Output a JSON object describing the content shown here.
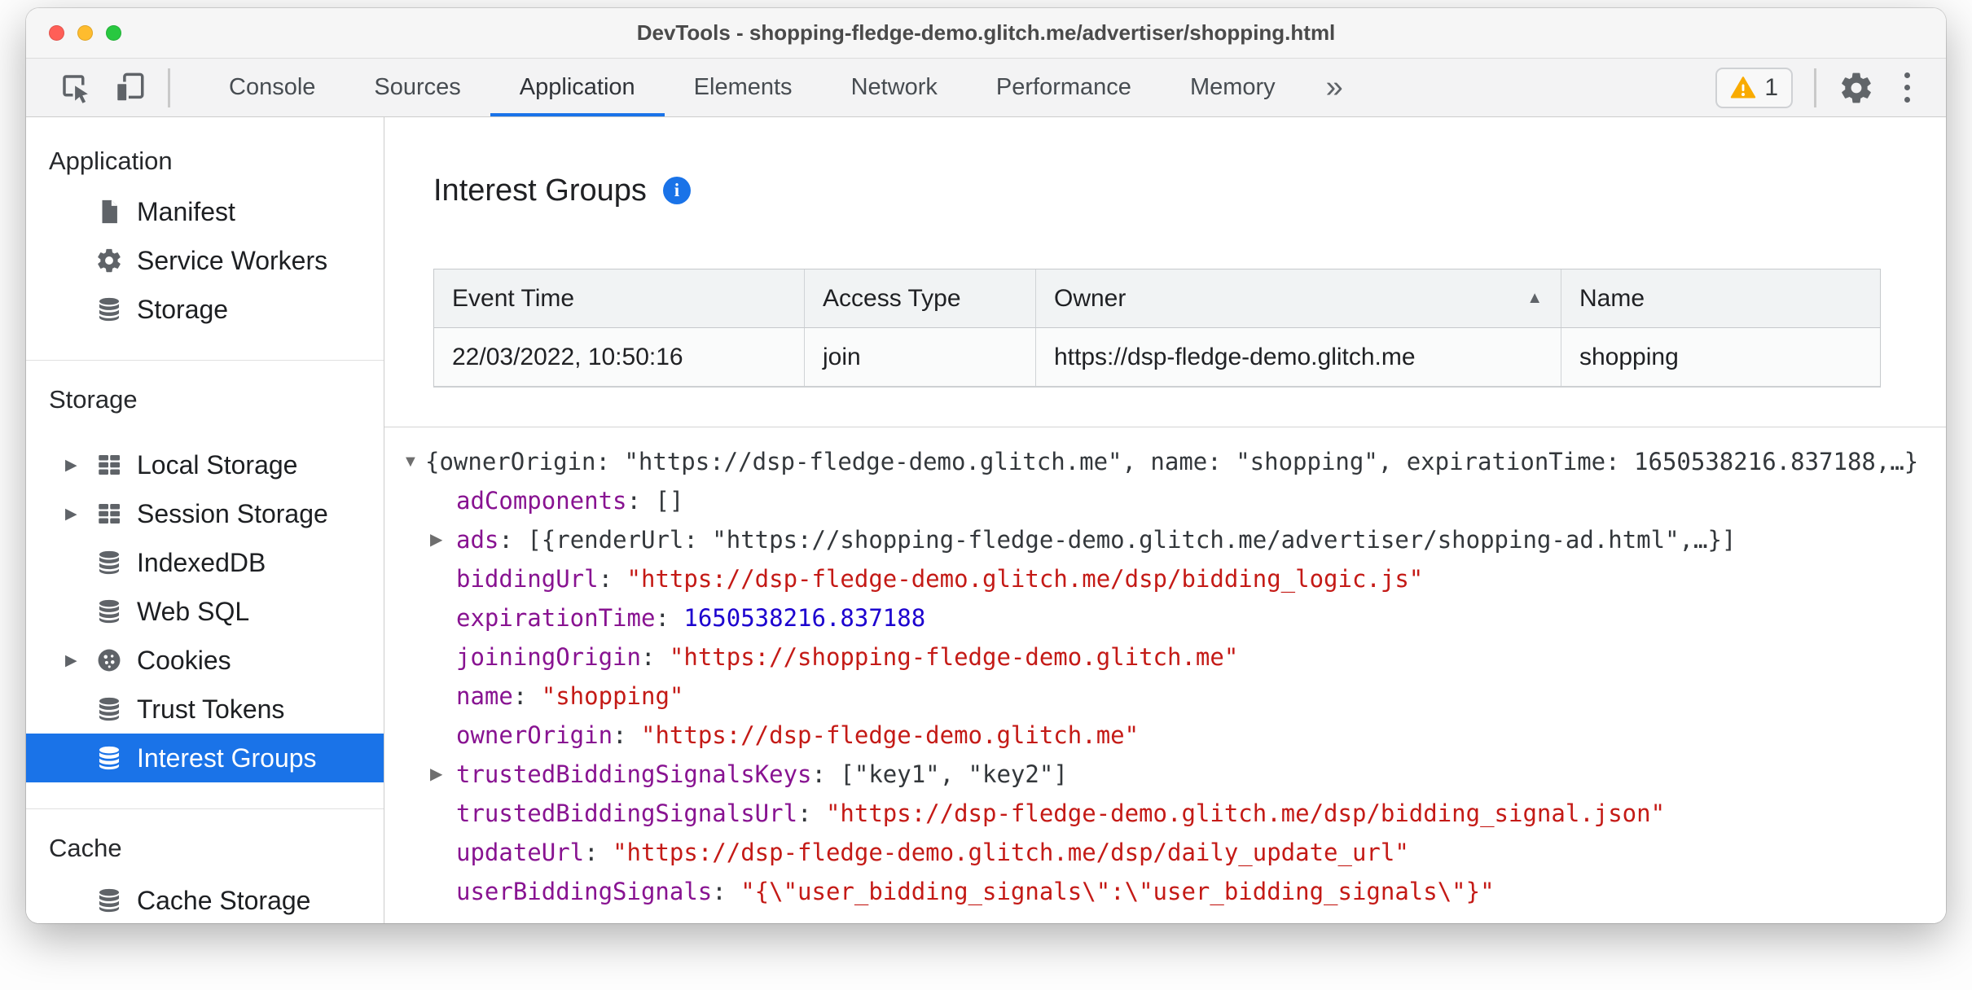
{
  "colors": {
    "accent": "#1a73e8",
    "key_purple": "#881391",
    "string_red": "#c41a16",
    "number_blue": "#1c00cf",
    "warning_yellow": "#f9ab00",
    "selected_bg": "#1a73e8"
  },
  "window": {
    "title": "DevTools - shopping-fledge-demo.glitch.me/advertiser/shopping.html"
  },
  "toolbar": {
    "tabs": [
      {
        "label": "Console"
      },
      {
        "label": "Sources"
      },
      {
        "label": "Application"
      },
      {
        "label": "Elements"
      },
      {
        "label": "Network"
      },
      {
        "label": "Performance"
      },
      {
        "label": "Memory"
      }
    ],
    "selected_tab": "Application",
    "overflow_label": "»",
    "warning_count": "1"
  },
  "sidebar": {
    "sections": [
      {
        "title": "Application",
        "items": [
          {
            "label": "Manifest",
            "icon": "document"
          },
          {
            "label": "Service Workers",
            "icon": "gear"
          },
          {
            "label": "Storage",
            "icon": "database"
          }
        ]
      },
      {
        "title": "Storage",
        "items": [
          {
            "label": "Local Storage",
            "icon": "table",
            "expander": "▶"
          },
          {
            "label": "Session Storage",
            "icon": "table",
            "expander": "▶"
          },
          {
            "label": "IndexedDB",
            "icon": "database"
          },
          {
            "label": "Web SQL",
            "icon": "database"
          },
          {
            "label": "Cookies",
            "icon": "cookie",
            "expander": "▶"
          },
          {
            "label": "Trust Tokens",
            "icon": "database"
          },
          {
            "label": "Interest Groups",
            "icon": "database",
            "selected": true
          }
        ]
      },
      {
        "title": "Cache",
        "items": [
          {
            "label": "Cache Storage",
            "icon": "database"
          }
        ]
      }
    ]
  },
  "main": {
    "title": "Interest Groups",
    "info_glyph": "i",
    "table": {
      "columns": [
        "Event Time",
        "Access Type",
        "Owner",
        "Name"
      ],
      "sort_column": "Owner",
      "sort_indicator": "▲",
      "rows": [
        [
          "22/03/2022, 10:50:16",
          "join",
          "https://dsp-fledge-demo.glitch.me",
          "shopping"
        ]
      ]
    },
    "tree": {
      "rows": [
        {
          "exp": "▼",
          "key": "",
          "sep": "",
          "value": "{ownerOrigin: \"https://dsp-fledge-demo.glitch.me\", name: \"shopping\", expirationTime: 1650538216.837188,…}",
          "type": "preview"
        },
        {
          "exp": "",
          "key": "adComponents",
          "sep": ": ",
          "value": "[]",
          "type": "preview"
        },
        {
          "exp": "▶",
          "key": "ads",
          "sep": ": ",
          "value": "[{renderUrl: \"https://shopping-fledge-demo.glitch.me/advertiser/shopping-ad.html\",…}]",
          "type": "preview"
        },
        {
          "exp": "",
          "key": "biddingUrl",
          "sep": ": ",
          "value": "\"https://dsp-fledge-demo.glitch.me/dsp/bidding_logic.js\"",
          "type": "string"
        },
        {
          "exp": "",
          "key": "expirationTime",
          "sep": ": ",
          "value": "1650538216.837188",
          "type": "number"
        },
        {
          "exp": "",
          "key": "joiningOrigin",
          "sep": ": ",
          "value": "\"https://shopping-fledge-demo.glitch.me\"",
          "type": "string"
        },
        {
          "exp": "",
          "key": "name",
          "sep": ": ",
          "value": "\"shopping\"",
          "type": "string"
        },
        {
          "exp": "",
          "key": "ownerOrigin",
          "sep": ": ",
          "value": "\"https://dsp-fledge-demo.glitch.me\"",
          "type": "string"
        },
        {
          "exp": "▶",
          "key": "trustedBiddingSignalsKeys",
          "sep": ": ",
          "value": "[\"key1\", \"key2\"]",
          "type": "preview"
        },
        {
          "exp": "",
          "key": "trustedBiddingSignalsUrl",
          "sep": ": ",
          "value": "\"https://dsp-fledge-demo.glitch.me/dsp/bidding_signal.json\"",
          "type": "string"
        },
        {
          "exp": "",
          "key": "updateUrl",
          "sep": ": ",
          "value": "\"https://dsp-fledge-demo.glitch.me/dsp/daily_update_url\"",
          "type": "string"
        },
        {
          "exp": "",
          "key": "userBiddingSignals",
          "sep": ": ",
          "value": "\"{\\\"user_bidding_signals\\\":\\\"user_bidding_signals\\\"}\"",
          "type": "string"
        }
      ]
    }
  }
}
